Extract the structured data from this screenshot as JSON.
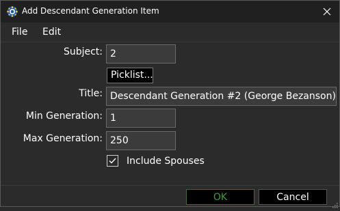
{
  "window": {
    "title": "Add Descendant Generation Item",
    "app_icon": "gear-icon",
    "close_icon": "close-icon"
  },
  "menu": {
    "items": [
      "File",
      "Edit"
    ]
  },
  "form": {
    "subject_label": "Subject:",
    "subject_value": "2",
    "picklist_label": "Picklist...",
    "title_label": "Title:",
    "title_value": "Descendant Generation #2 (George Bezanson)",
    "min_label": "Min Generation:",
    "min_value": "1",
    "max_label": "Max Generation:",
    "max_value": "250",
    "include_spouses_label": "Include Spouses",
    "include_spouses_checked": true
  },
  "footer": {
    "ok_label": "OK",
    "cancel_label": "Cancel"
  },
  "colors": {
    "background": "#2b2b2b",
    "titlebar": "#202020",
    "field_bg": "#3b3b3b",
    "ok_text": "#3f9a3f"
  }
}
